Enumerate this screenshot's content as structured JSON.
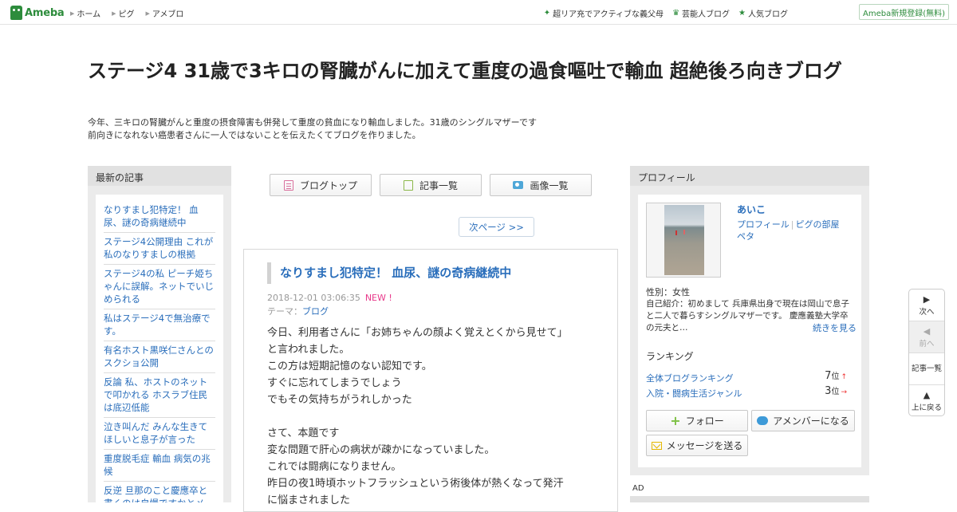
{
  "topbar": {
    "logo_text": "Ameba",
    "nav": [
      "ホーム",
      "ピグ",
      "アメブロ"
    ],
    "links": [
      {
        "icon": "sparkle-icon",
        "label": "超リア充でアクティブな義父母"
      },
      {
        "icon": "crown-icon",
        "label": "芸能人ブログ"
      },
      {
        "icon": "star-icon",
        "label": "人気ブログ"
      }
    ],
    "register_label": "Ameba新規登録(無料)"
  },
  "header": {
    "title": "ステージ4 31歳で3キロの腎臓がんに加えて重度の過食嘔吐で輸血 超絶後ろ向きブログ",
    "description_line1": "今年、三キロの腎臓がんと重度の摂食障害も併発して重度の貧血になり輸血しました。31歳のシングルマザーです",
    "description_line2": "前向きになれない癌患者さんに一人ではないことを伝えたくてブログを作りました。"
  },
  "left_sidebar": {
    "heading": "最新の記事",
    "entries": [
      "なりすまし犯特定！ 血尿、謎の奇病継続中",
      "ステージ4公開理由 これが私のなりすましの根拠",
      "ステージ4の私 ピーチ姫ちゃんに誤解。ネットでいじめられる",
      "私はステージ4で無治療です。",
      "有名ホスト黒咲仁さんとのスクショ公開",
      "反論 私、ホストのネットで叩かれる ホスラブ住民は底辺低能",
      "泣き叫んだ みんな生きてほしいと息子が言った",
      "重度脱毛症 輸血 病気の兆候",
      "反逆 旦那のこと慶應卒と書くのは自慢ですかとメ"
    ]
  },
  "center": {
    "buttons": {
      "blog_top": "ブログトップ",
      "article_list": "記事一覧",
      "image_list": "画像一覧"
    },
    "next_page": "次ページ >>",
    "article": {
      "title": "なりすまし犯特定！ 血尿、謎の奇病継続中",
      "date": "2018-12-01 03:06:35",
      "new_badge": "NEW !",
      "theme_label": "テーマ：",
      "theme_value": "ブログ",
      "body_lines": [
        "今日、利用者さんに「お姉ちゃんの顔よく覚えとくから見せて」",
        "と言われました。",
        "この方は短期記憶のない認知です。",
        "すぐに忘れてしまうでしょう",
        "でもその気持ちがうれしかった",
        "",
        "さて、本題です",
        "変な問題で肝心の病状が疎かになっていました。",
        "これでは闘病になりません。",
        "昨日の夜1時頃ホットフラッシュという術後体が熱くなって発汗",
        "に悩まされました"
      ]
    }
  },
  "profile": {
    "heading": "プロフィール",
    "name": "あいこ",
    "link_profile": "プロフィール",
    "link_room": "ピグの部屋",
    "link_peta": "ペタ",
    "gender": "性別：女性",
    "intro": "自己紹介：初めまして 兵庫県出身で現在は岡山で息子と二人で暮らすシングルマザーです。 慶應義塾大学卒の元夫と…",
    "more": "続きを見る",
    "ranking_heading": "ランキング",
    "rankings": [
      {
        "name": "全体ブログランキング",
        "rank": "7",
        "unit": "位",
        "trend": "↑"
      },
      {
        "name": "入院・闘病生活ジャンル",
        "rank": "3",
        "unit": "位",
        "trend": "→"
      }
    ],
    "follow_label": "フォロー",
    "amember_label": "アメンバーになる",
    "message_label": "メッセージを送る",
    "ad_label": "AD"
  },
  "pager": {
    "next": "次へ",
    "prev": "前へ",
    "list": "記事一覧",
    "top": "上に戻る"
  }
}
